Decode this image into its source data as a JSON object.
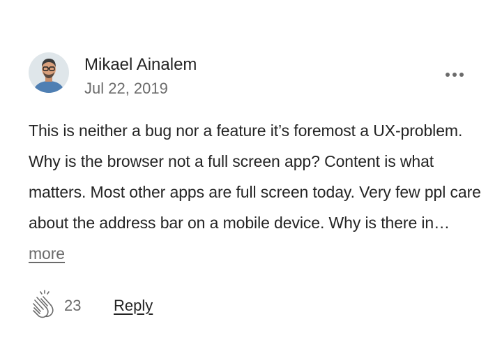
{
  "comment": {
    "author": {
      "name": "Mikael Ainalem",
      "avatar": "avatar-photo"
    },
    "date": "Jul 22, 2019",
    "options_icon": "more-horizontal-icon",
    "body_text": "This is neither a bug nor a feature it’s foremost a UX-problem. Why is the browser not a full screen app? Content is what matters. Most other apps are full screen today. Very few ppl care about the address bar on a mobile device. Why is there in…",
    "more_label": "more",
    "footer": {
      "clap_icon": "clap-icon",
      "clap_count": "23",
      "reply_label": "Reply"
    }
  },
  "colors": {
    "text_primary": "#242424",
    "text_secondary": "#6b6b6b"
  }
}
